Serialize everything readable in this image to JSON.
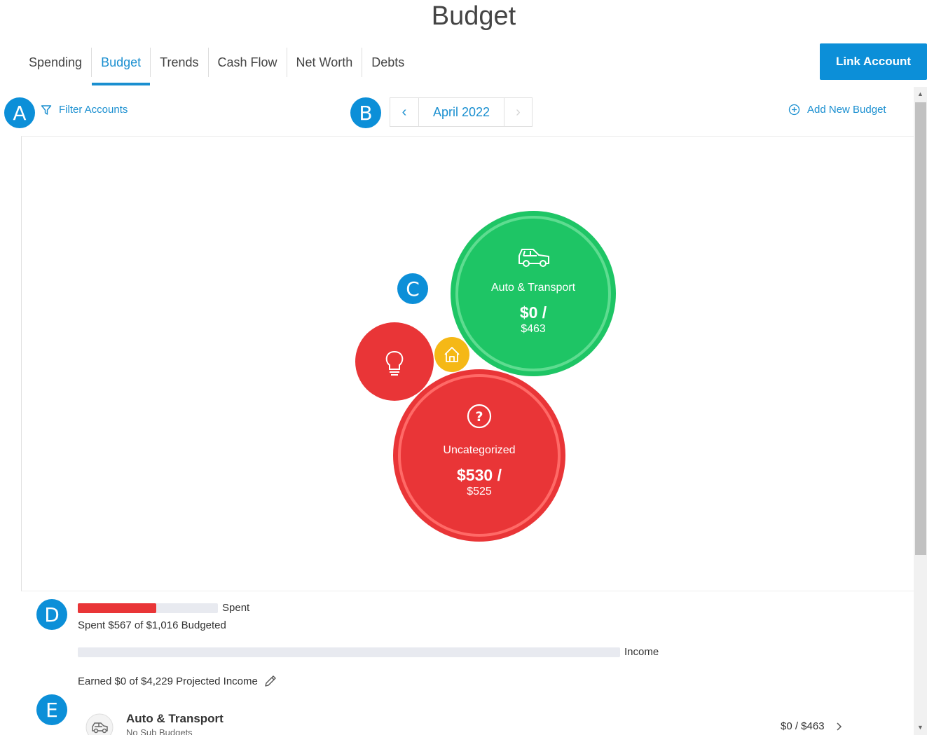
{
  "page": {
    "title": "Budget"
  },
  "tabs": [
    {
      "label": "Spending",
      "active": false
    },
    {
      "label": "Budget",
      "active": true
    },
    {
      "label": "Trends",
      "active": false
    },
    {
      "label": "Cash Flow",
      "active": false
    },
    {
      "label": "Net Worth",
      "active": false
    },
    {
      "label": "Debts",
      "active": false
    }
  ],
  "header": {
    "link_account_label": "Link Account"
  },
  "toolbar": {
    "filter_label": "Filter Accounts",
    "month_label": "April 2022",
    "prev_arrow": "‹",
    "next_arrow": "›",
    "add_budget_label": "Add New Budget"
  },
  "markers": {
    "a": "A",
    "b": "B",
    "c": "C",
    "d": "D",
    "e": "E"
  },
  "bubbles": {
    "auto": {
      "name": "Auto & Transport",
      "spent": "$0 /",
      "budget": "$463",
      "color": "#1ec565",
      "icon": "car-icon"
    },
    "uncategorized": {
      "name": "Uncategorized",
      "spent": "$530 /",
      "budget": "$525",
      "color": "#e93537",
      "icon": "question-icon"
    },
    "utilities": {
      "color": "#e93537",
      "icon": "lightbulb-icon"
    },
    "home": {
      "color": "#f5b816",
      "icon": "house-icon"
    }
  },
  "summary": {
    "spent_label": "Spent",
    "spent_text": "Spent $567 of $1,016 Budgeted",
    "spent_fraction": 0.558,
    "income_label": "Income",
    "income_text": "Earned $0 of $4,229 Projected Income",
    "income_fraction": 0
  },
  "budget_list": [
    {
      "name": "Auto & Transport",
      "sub": "No Sub Budgets",
      "amount": "$0 / $463",
      "icon": "car-icon"
    }
  ],
  "colors": {
    "accent": "#0c8fd8",
    "over": "#e93537",
    "under": "#1ec565",
    "warn": "#f5b816"
  }
}
